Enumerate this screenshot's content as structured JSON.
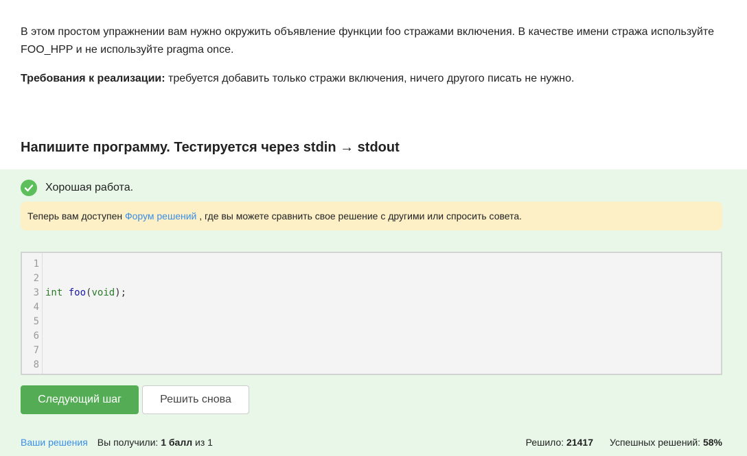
{
  "task": {
    "paragraph1": "В этом простом упражнении вам нужно окружить объявление функции foo стражами включения. В качестве имени стража используйте FOO_HPP и не используйте pragma once.",
    "req_label": "Требования к реализации:",
    "req_text": " требуется добавить только стражи включения, ничего другого писать не нужно."
  },
  "step_title": "Напишите программу. Тестируется через stdin → stdout",
  "status": {
    "text": "Хорошая работа.",
    "color": "#5cbf5c"
  },
  "notice": {
    "prefix": "Теперь вам доступен ",
    "link": "Форум решений",
    "suffix": " , где вы можете сравнить свое решение с другими или спросить совета."
  },
  "editor": {
    "line_numbers": [
      "1",
      "2",
      "3",
      "4",
      "5",
      "6",
      "7",
      "8"
    ],
    "code_line_3": {
      "kw1": "int",
      "space": " ",
      "fn": "foo",
      "open": "(",
      "kw2": "void",
      "close": ");"
    }
  },
  "buttons": {
    "next": "Следующий шаг",
    "retry": "Решить снова"
  },
  "footer": {
    "my_solutions": "Ваши решения",
    "got_prefix": "Вы получили: ",
    "score": "1 балл",
    "of": " из 1",
    "solved_label": "Решило: ",
    "solved_count": "21417",
    "success_label": "Успешных решений: ",
    "success_rate": "58%"
  },
  "colors": {
    "accent_green": "#54ad54",
    "link_blue": "#3a8ee6",
    "notice_bg": "#fdf0c7",
    "result_bg": "#e8f7e8"
  }
}
